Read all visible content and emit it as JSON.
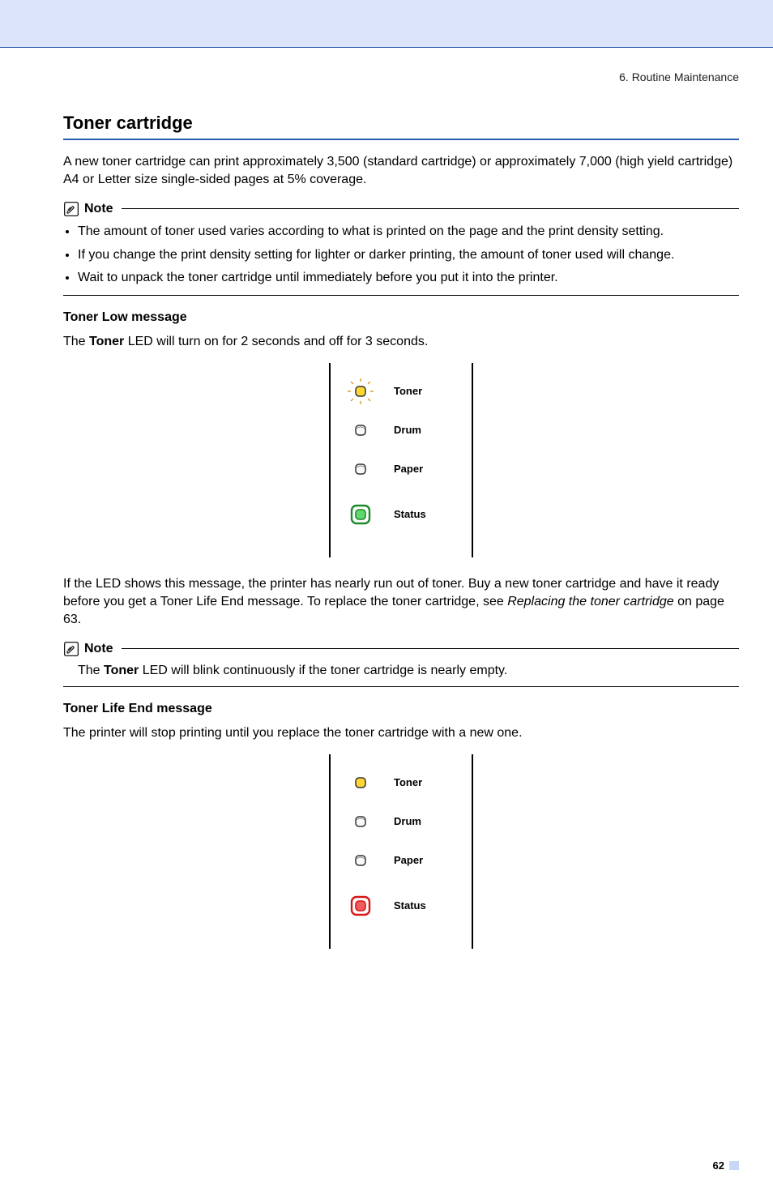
{
  "breadcrumb": "6. Routine Maintenance",
  "title": "Toner cartridge",
  "intro": "A new toner cartridge can print approximately 3,500 (standard cartridge) or approximately 7,000 (high yield cartridge) A4 or Letter size single-sided pages at 5% coverage.",
  "note_label": "Note",
  "note1_items": [
    "The amount of toner used varies according to what is printed on the page and the print density setting.",
    "If you change the print density setting for lighter or darker printing, the amount of toner used will change.",
    "Wait to unpack the toner cartridge until immediately before you put it into the printer."
  ],
  "sectionA": {
    "heading": "Toner Low message",
    "p1_a": "The ",
    "p1_bold": "Toner",
    "p1_b": " LED will turn on for 2 seconds and off for 3 seconds.",
    "after_a": "If the LED shows this message, the printer has nearly run out of toner. Buy a new toner cartridge and have it ready before you get a Toner Life End message. To replace the toner cartridge, see ",
    "after_italic": "Replacing the toner cartridge",
    "after_b": " on page 63."
  },
  "panel_labels": {
    "toner": "Toner",
    "drum": "Drum",
    "paper": "Paper",
    "status": "Status"
  },
  "note2_a": "The ",
  "note2_bold": "Toner",
  "note2_b": " LED will blink continuously if the toner cartridge is nearly empty.",
  "sectionB": {
    "heading": "Toner Life End message",
    "p1": "The printer will stop printing until you replace the toner cartridge with a new one."
  },
  "page_number": "62"
}
